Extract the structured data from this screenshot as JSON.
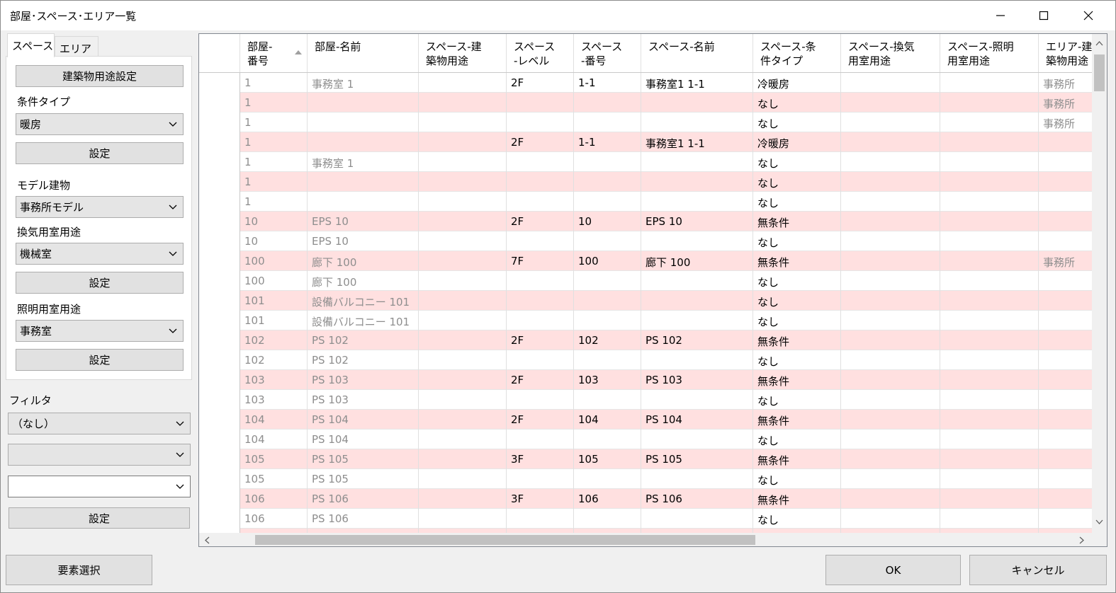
{
  "window": {
    "title": "部屋･スペース･エリア一覧"
  },
  "tabs": [
    {
      "label": "スペース"
    },
    {
      "label": "エリア"
    }
  ],
  "space_panel": {
    "usage_button": "建築物用途設定",
    "condition_label": "条件タイプ",
    "condition_value": "暖房",
    "condition_set": "設定",
    "model_label": "モデル建物",
    "model_value": "事務所モデル",
    "vent_label": "換気用室用途",
    "vent_value": "機械室",
    "vent_set": "設定",
    "light_label": "照明用室用途",
    "light_value": "事務室",
    "light_set": "設定"
  },
  "filter": {
    "label": "フィルタ",
    "select1": "（なし）",
    "select2": "",
    "select3": "",
    "set": "設定"
  },
  "footer": {
    "select_button": "要素選択",
    "ok": "OK",
    "cancel": "キャンセル"
  },
  "table": {
    "sorted_column": 0,
    "columns": [
      "部屋-\n番号",
      "部屋-名前",
      "スペース-建\n築物用途",
      "スペース\n-レベル",
      "スペース\n-番号",
      "スペース-名前",
      "スペース-条\n件タイプ",
      "スペース-換気\n用室用途",
      "スペース-照明\n用室用途",
      "エリア-建\n築物用途"
    ],
    "rows": [
      {
        "pink": false,
        "cells": [
          "1",
          "事務室 1",
          "",
          "2F",
          "1-1",
          "事務室1 1-1",
          "冷暖房",
          "",
          "",
          "事務所"
        ]
      },
      {
        "pink": true,
        "cells": [
          "1",
          "",
          "",
          "",
          "",
          "",
          "なし",
          "",
          "",
          "事務所"
        ]
      },
      {
        "pink": false,
        "cells": [
          "1",
          "",
          "",
          "",
          "",
          "",
          "なし",
          "",
          "",
          "事務所"
        ]
      },
      {
        "pink": true,
        "cells": [
          "1",
          "",
          "",
          "2F",
          "1-1",
          "事務室1 1-1",
          "冷暖房",
          "",
          "",
          ""
        ]
      },
      {
        "pink": false,
        "cells": [
          "1",
          "事務室 1",
          "",
          "",
          "",
          "",
          "なし",
          "",
          "",
          ""
        ]
      },
      {
        "pink": true,
        "cells": [
          "1",
          "",
          "",
          "",
          "",
          "",
          "なし",
          "",
          "",
          ""
        ]
      },
      {
        "pink": false,
        "cells": [
          "1",
          "",
          "",
          "",
          "",
          "",
          "なし",
          "",
          "",
          ""
        ]
      },
      {
        "pink": true,
        "cells": [
          "10",
          "EPS 10",
          "",
          "2F",
          "10",
          "EPS 10",
          "無条件",
          "",
          "",
          ""
        ]
      },
      {
        "pink": false,
        "cells": [
          "10",
          "EPS 10",
          "",
          "",
          "",
          "",
          "なし",
          "",
          "",
          ""
        ]
      },
      {
        "pink": true,
        "cells": [
          "100",
          "廊下 100",
          "",
          "7F",
          "100",
          "廊下 100",
          "無条件",
          "",
          "",
          "事務所"
        ]
      },
      {
        "pink": false,
        "cells": [
          "100",
          "廊下 100",
          "",
          "",
          "",
          "",
          "なし",
          "",
          "",
          ""
        ]
      },
      {
        "pink": true,
        "cells": [
          "101",
          "設備バルコニー 101",
          "",
          "",
          "",
          "",
          "なし",
          "",
          "",
          ""
        ]
      },
      {
        "pink": false,
        "cells": [
          "101",
          "設備バルコニー 101",
          "",
          "",
          "",
          "",
          "なし",
          "",
          "",
          ""
        ]
      },
      {
        "pink": true,
        "cells": [
          "102",
          "PS 102",
          "",
          "2F",
          "102",
          "PS 102",
          "無条件",
          "",
          "",
          ""
        ]
      },
      {
        "pink": false,
        "cells": [
          "102",
          "PS 102",
          "",
          "",
          "",
          "",
          "なし",
          "",
          "",
          ""
        ]
      },
      {
        "pink": true,
        "cells": [
          "103",
          "PS 103",
          "",
          "2F",
          "103",
          "PS 103",
          "無条件",
          "",
          "",
          ""
        ]
      },
      {
        "pink": false,
        "cells": [
          "103",
          "PS 103",
          "",
          "",
          "",
          "",
          "なし",
          "",
          "",
          ""
        ]
      },
      {
        "pink": true,
        "cells": [
          "104",
          "PS 104",
          "",
          "2F",
          "104",
          "PS 104",
          "無条件",
          "",
          "",
          ""
        ]
      },
      {
        "pink": false,
        "cells": [
          "104",
          "PS 104",
          "",
          "",
          "",
          "",
          "なし",
          "",
          "",
          ""
        ]
      },
      {
        "pink": true,
        "cells": [
          "105",
          "PS 105",
          "",
          "3F",
          "105",
          "PS 105",
          "無条件",
          "",
          "",
          ""
        ]
      },
      {
        "pink": false,
        "cells": [
          "105",
          "PS 105",
          "",
          "",
          "",
          "",
          "なし",
          "",
          "",
          ""
        ]
      },
      {
        "pink": true,
        "cells": [
          "106",
          "PS 106",
          "",
          "3F",
          "106",
          "PS 106",
          "無条件",
          "",
          "",
          ""
        ]
      },
      {
        "pink": false,
        "cells": [
          "106",
          "PS 106",
          "",
          "",
          "",
          "",
          "なし",
          "",
          "",
          ""
        ]
      },
      {
        "pink": true,
        "cells": [
          "",
          "",
          "",
          "",
          "",
          "",
          "",
          "",
          "",
          ""
        ]
      }
    ]
  },
  "colors": {
    "row_alt": "#ffe0e0",
    "grey_text": "#8e8e8e"
  },
  "icons": {
    "minimize": "minimize-icon",
    "maximize": "maximize-icon",
    "close": "close-icon",
    "dropdown": "chevron-down-icon",
    "sort": "sort-ascending-icon"
  }
}
